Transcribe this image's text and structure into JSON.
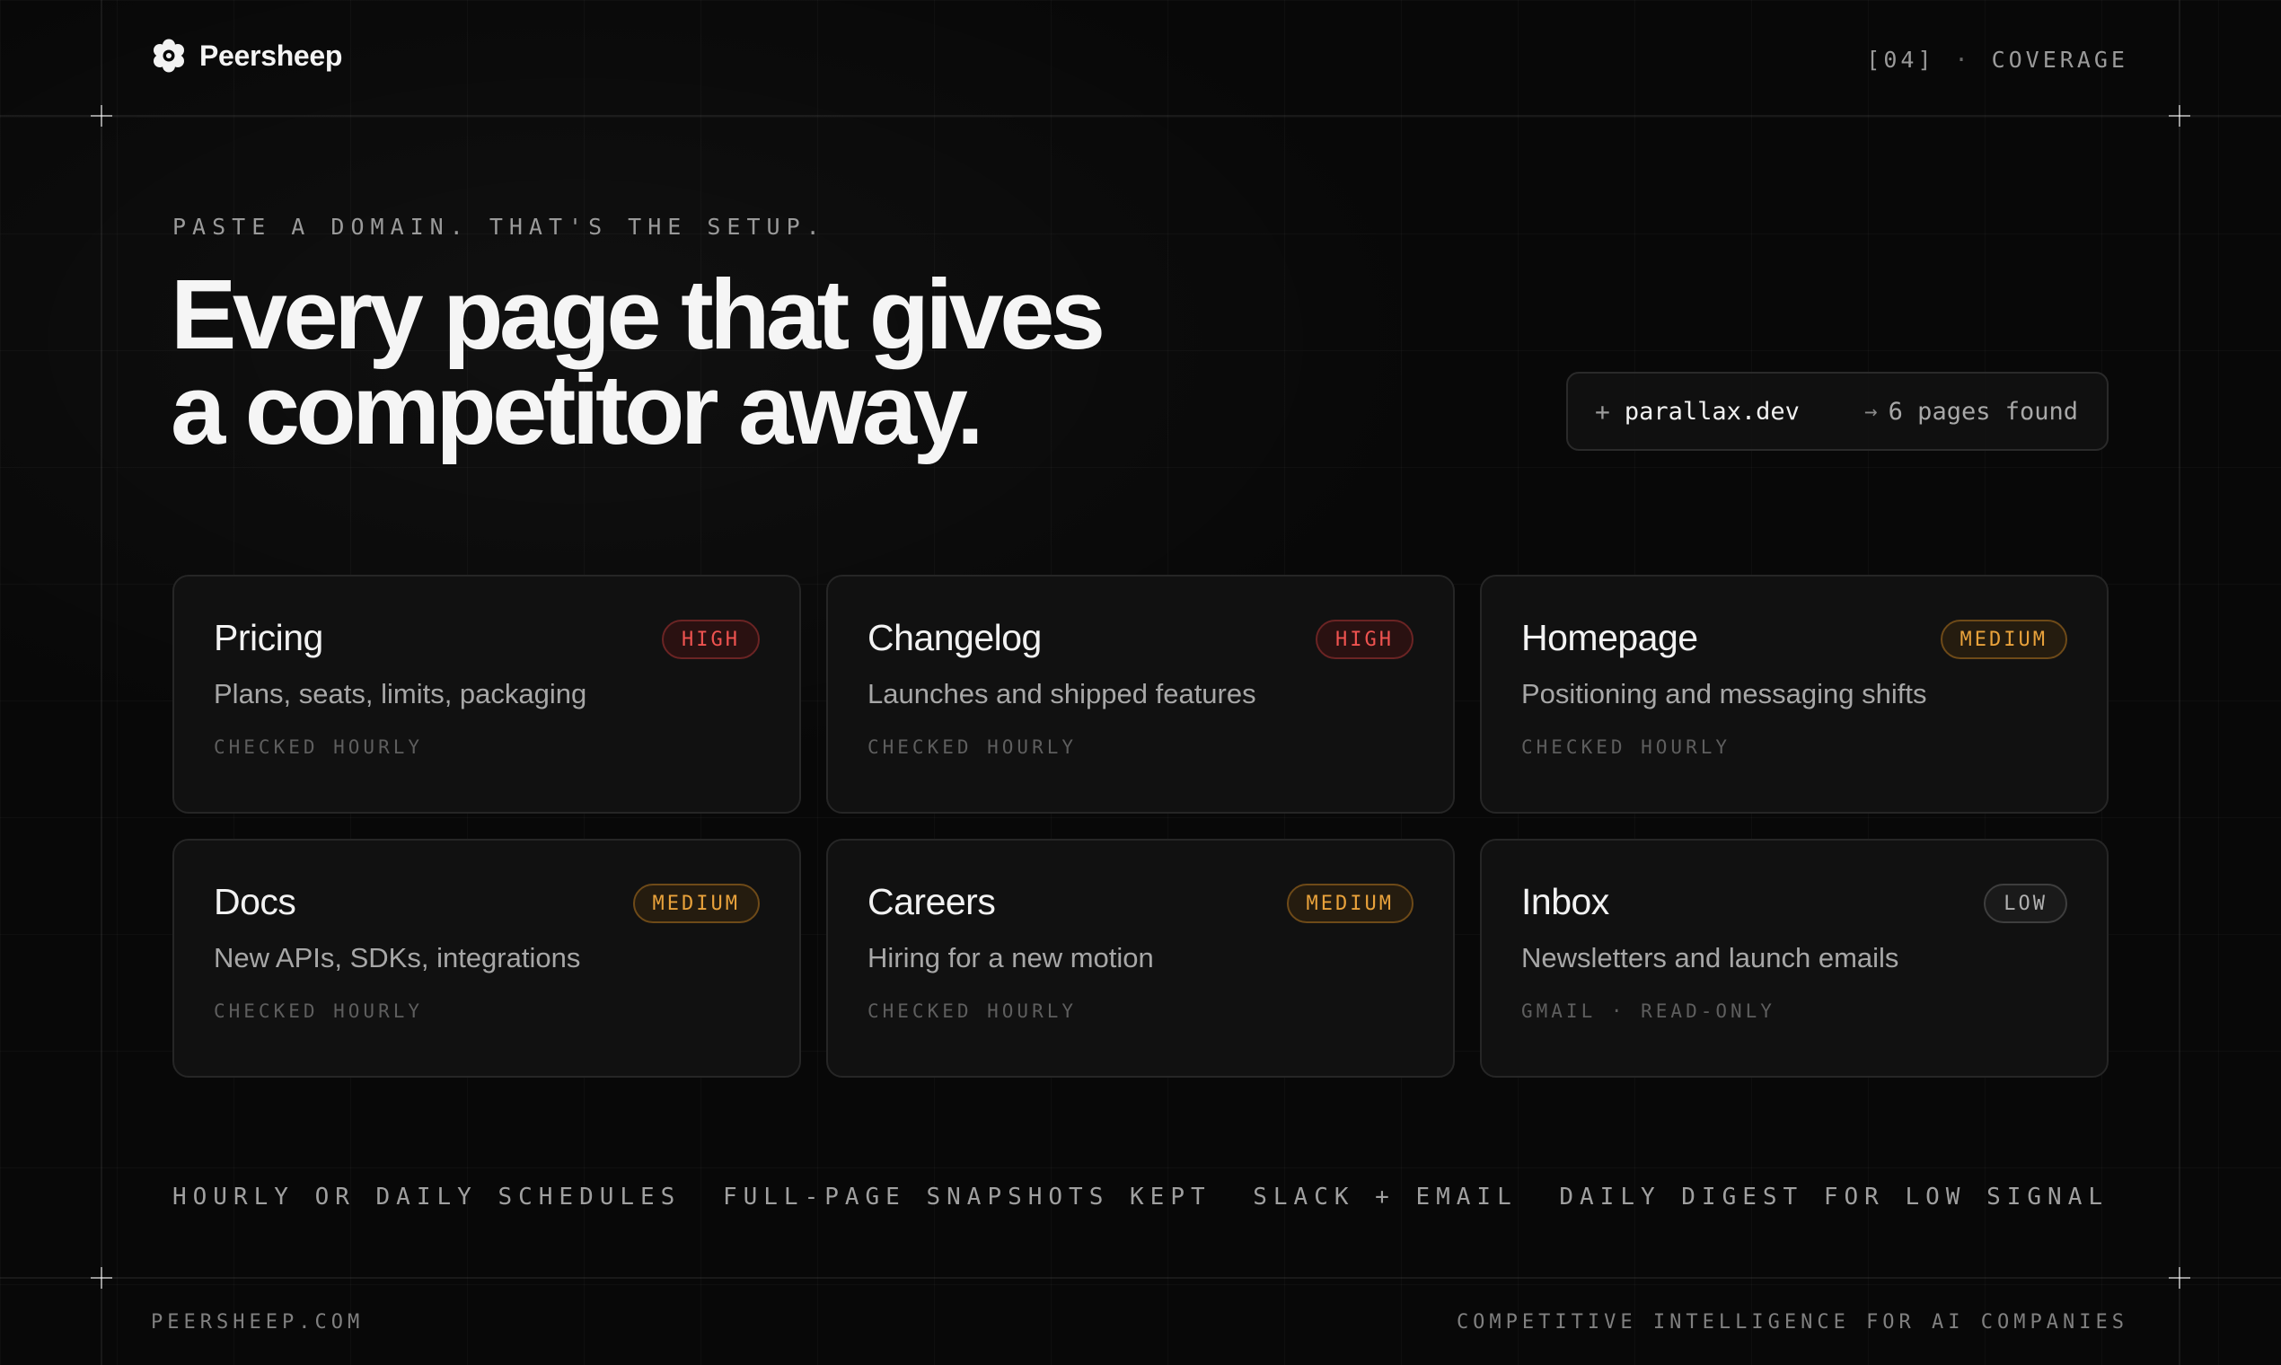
{
  "brand": {
    "name": "Peersheep",
    "icon": "sheep-logo-icon"
  },
  "section": {
    "index": "[04]",
    "separator": "·",
    "label": "COVERAGE"
  },
  "hero": {
    "eyebrow": "PASTE A DOMAIN. THAT'S THE SETUP.",
    "headline_line1": "Every page that gives",
    "headline_line2": "a competitor away."
  },
  "domain_input": {
    "prefix": "+",
    "domain": "parallax.dev",
    "arrow": "→",
    "result": "6 pages found"
  },
  "cards": [
    {
      "title": "Pricing",
      "badge": "HIGH",
      "level": "high",
      "desc": "Plans, seats, limits, packaging",
      "meta": "CHECKED HOURLY"
    },
    {
      "title": "Changelog",
      "badge": "HIGH",
      "level": "high",
      "desc": "Launches and shipped features",
      "meta": "CHECKED HOURLY"
    },
    {
      "title": "Homepage",
      "badge": "MEDIUM",
      "level": "medium",
      "desc": "Positioning and messaging shifts",
      "meta": "CHECKED HOURLY"
    },
    {
      "title": "Docs",
      "badge": "MEDIUM",
      "level": "medium",
      "desc": "New APIs, SDKs, integrations",
      "meta": "CHECKED HOURLY"
    },
    {
      "title": "Careers",
      "badge": "MEDIUM",
      "level": "medium",
      "desc": "Hiring for a new motion",
      "meta": "CHECKED HOURLY"
    },
    {
      "title": "Inbox",
      "badge": "LOW",
      "level": "low",
      "desc": "Newsletters and launch emails",
      "meta": "GMAIL · READ-ONLY"
    }
  ],
  "features": [
    "HOURLY OR DAILY SCHEDULES",
    "FULL-PAGE SNAPSHOTS KEPT",
    "SLACK + EMAIL",
    "DAILY DIGEST FOR LOW SIGNAL"
  ],
  "footer": {
    "left": "PEERSHEEP.COM",
    "right": "COMPETITIVE INTELLIGENCE FOR AI COMPANIES"
  },
  "colors": {
    "background": "#080808",
    "card": "#111111",
    "high": "#ef5350",
    "medium": "#e9a23b",
    "low": "#b0b0b0"
  }
}
